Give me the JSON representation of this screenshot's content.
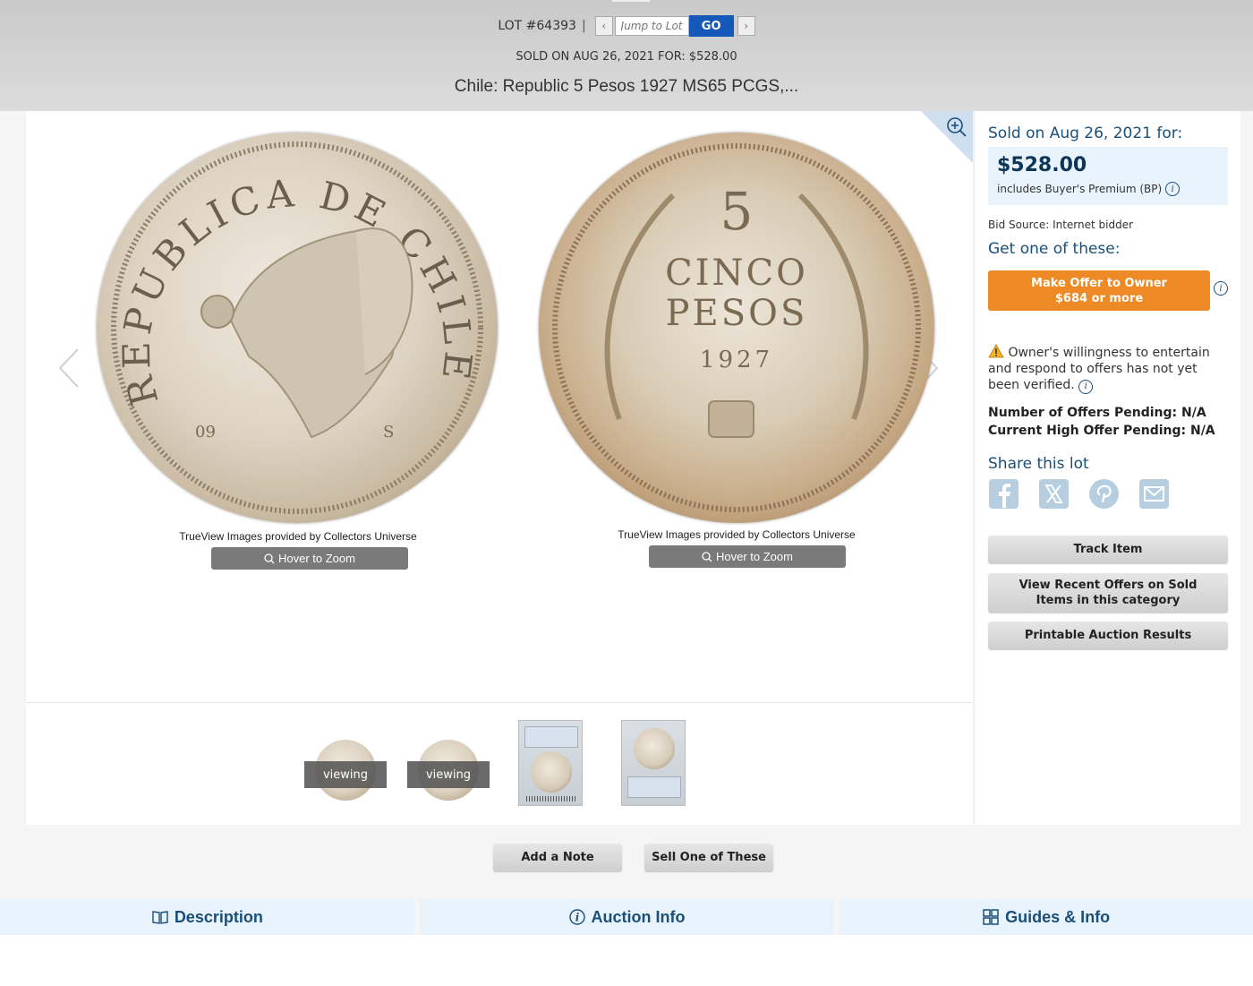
{
  "header": {
    "lot_label": "LOT #64393",
    "separator": "|",
    "prev_icon": "chevron-left-icon",
    "next_icon": "chevron-right-icon",
    "jump_placeholder": "Jump to Lot",
    "go_label": "GO",
    "sold_line": "SOLD ON AUG 26, 2021 FOR: $528.00",
    "title": "Chile: Republic 5 Pesos 1927 MS65 PCGS,..."
  },
  "gallery": {
    "zoom_icon": "zoom-in-icon",
    "prev_icon": "chevron-left-icon",
    "next_icon": "chevron-right-icon",
    "images": [
      {
        "credit": "TrueView Images provided by Collectors Universe",
        "hover_label": "Hover to Zoom",
        "legend": "REPUBLICA DE CHILE",
        "mint": "09",
        "side": "S"
      },
      {
        "credit": "TrueView Images provided by Collectors Universe",
        "hover_label": "Hover to Zoom",
        "numeral": "5",
        "line1": "CINCO",
        "line2": "PESOS",
        "year": "1927"
      }
    ],
    "thumbnails": [
      {
        "type": "coin",
        "overlay": "viewing"
      },
      {
        "type": "coin",
        "overlay": "viewing"
      },
      {
        "type": "slab-obverse",
        "overlay": ""
      },
      {
        "type": "slab-reverse",
        "overlay": ""
      }
    ]
  },
  "sidebar": {
    "sold_on": "Sold on Aug 26, 2021 for:",
    "price": "$528.00",
    "bp_note": "includes Buyer's Premium (BP)",
    "bid_source": "Bid Source: Internet bidder",
    "get_one": "Get one of these:",
    "offer_line1": "Make Offer to Owner",
    "offer_line2": "$684 or more",
    "warning_text": "Owner's willingness to entertain and respond to offers has not yet been verified.",
    "offers_pending": "Number of Offers Pending: N/A",
    "high_offer": "Current High Offer Pending: N/A",
    "share_title": "Share this lot",
    "share_icons": [
      "facebook-icon",
      "x-icon",
      "pinterest-icon",
      "email-icon"
    ],
    "track_label": "Track Item",
    "recent_label": "View Recent Offers on Sold Items in this category",
    "printable_label": "Printable Auction Results"
  },
  "actions": {
    "add_note": "Add a Note",
    "sell_one": "Sell One of These"
  },
  "tabs": [
    {
      "label": "Description",
      "icon": "book-icon"
    },
    {
      "label": "Auction Info",
      "icon": "info-icon"
    },
    {
      "label": "Guides & Info",
      "icon": "grid-icon"
    }
  ],
  "colors": {
    "accent": "#1a4f7a",
    "go_button": "#1558b8",
    "offer_button": "#ee8a25",
    "tab_bg": "#e9f3fb"
  }
}
